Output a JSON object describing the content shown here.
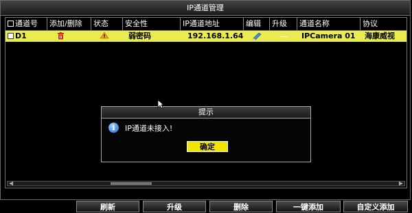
{
  "window": {
    "title": "IP通道管理"
  },
  "table": {
    "headers": {
      "channel": "通道号",
      "add_delete": "添加/删除",
      "status": "状态",
      "security": "安全性",
      "ip": "IP通道地址",
      "edit": "编辑",
      "upgrade": "升级",
      "name": "通道名称",
      "protocol": "协议"
    },
    "rows": [
      {
        "channel": "D1",
        "add_delete_icon": "trash-icon",
        "status_icon": "warning-icon",
        "security": "弱密码",
        "ip": "192.168.1.64",
        "edit_icon": "edit-pencil-icon",
        "upgrade": "—",
        "name": "IPCamera 01",
        "protocol": "海康威视"
      }
    ]
  },
  "dialog": {
    "title": "提示",
    "icon": "info-icon",
    "message": "IP通道未接入!",
    "ok_label": "确定"
  },
  "buttons": {
    "refresh": "刷新",
    "upgrade": "升级",
    "delete": "删除",
    "one_key_add": "一键添加",
    "custom_add": "自定义添加"
  },
  "colors": {
    "row_highlight": "#e9ec4e",
    "ok_button": "#f2e600",
    "trash": "#d42a1c",
    "warning": "#f0a020",
    "info": "#1d67c7"
  }
}
